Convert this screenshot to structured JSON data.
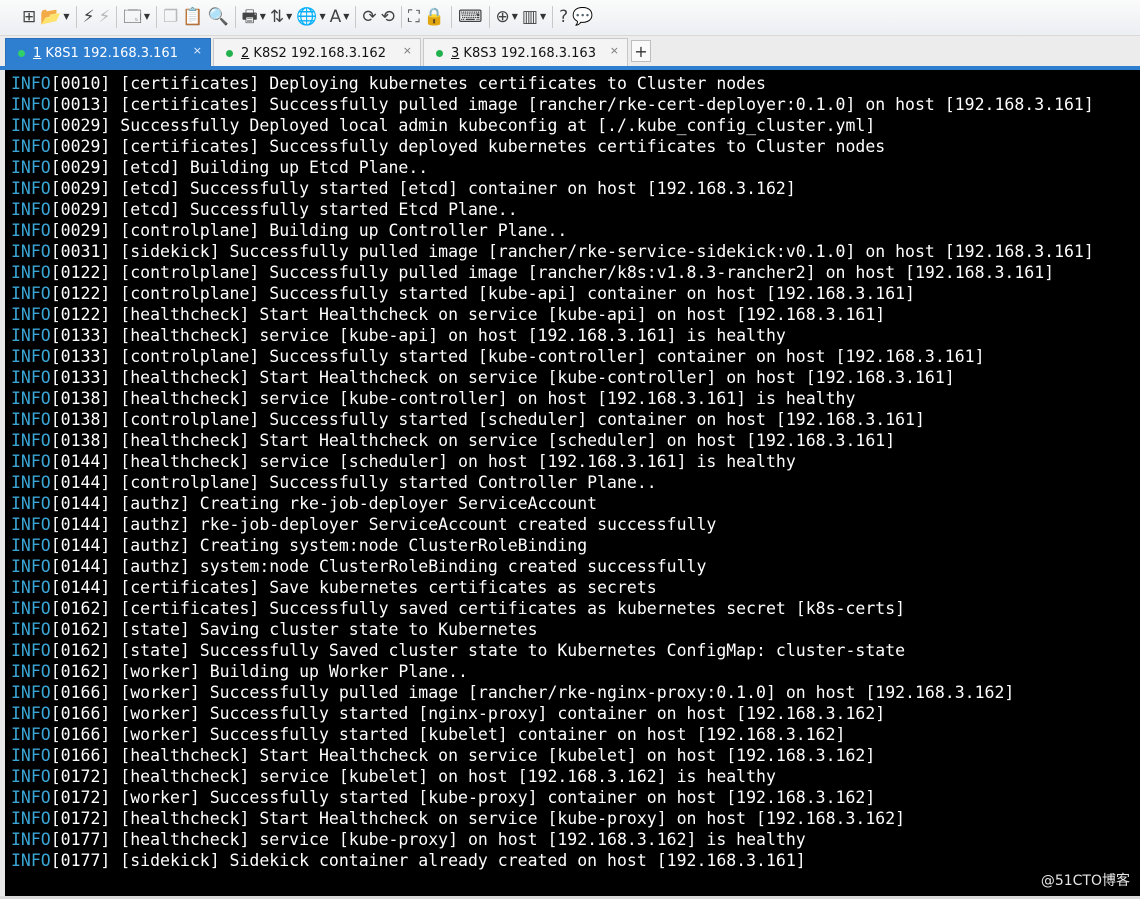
{
  "toolbar": {
    "buttons": [
      {
        "name": "new-session-icon",
        "glyph": "⊞",
        "dropdown": false
      },
      {
        "name": "open-folder-icon",
        "glyph": "📂",
        "dropdown": true
      },
      {
        "name": "connect-icon",
        "glyph": "⚡",
        "dropdown": false
      },
      {
        "name": "disconnect-icon",
        "glyph": "⚡",
        "dropdown": false,
        "dim": true
      },
      {
        "name": "new-window-icon",
        "glyph": "🗔",
        "dropdown": true
      },
      {
        "name": "copy-icon",
        "glyph": "❐",
        "dropdown": false,
        "dim": true
      },
      {
        "name": "paste-icon",
        "glyph": "📋",
        "dropdown": false
      },
      {
        "name": "find-icon",
        "glyph": "🔍",
        "dropdown": false
      },
      {
        "name": "print-icon",
        "glyph": "🖶",
        "dropdown": true
      },
      {
        "name": "transfer-icon",
        "glyph": "⇅",
        "dropdown": true
      },
      {
        "name": "globe-icon",
        "glyph": "🌐",
        "dropdown": true
      },
      {
        "name": "font-icon",
        "glyph": "A",
        "dropdown": true
      },
      {
        "name": "script-icon",
        "glyph": "⟳",
        "dropdown": false
      },
      {
        "name": "macro-icon",
        "glyph": "⟲",
        "dropdown": false
      },
      {
        "name": "fullscreen-icon",
        "glyph": "⛶",
        "dropdown": false
      },
      {
        "name": "lock-icon",
        "glyph": "🔒",
        "dropdown": false
      },
      {
        "name": "keyboard-icon",
        "glyph": "⌨",
        "dropdown": false
      },
      {
        "name": "new-tab-icon",
        "glyph": "⊕",
        "dropdown": true
      },
      {
        "name": "layout-icon",
        "glyph": "▥",
        "dropdown": true
      },
      {
        "name": "help-icon",
        "glyph": "?",
        "dropdown": false
      },
      {
        "name": "chat-icon",
        "glyph": "💬",
        "dropdown": false,
        "dim": true
      }
    ]
  },
  "tabs": [
    {
      "key": "1",
      "label": " K8S1 192.168.3.161",
      "active": true,
      "close": "×"
    },
    {
      "key": "2",
      "label": " K8S2 192.168.3.162",
      "active": false,
      "close": "×"
    },
    {
      "key": "3",
      "label": " K8S3 192.168.3.163",
      "active": false,
      "close": "×"
    }
  ],
  "add_tab_label": "+",
  "terminal": {
    "lines": [
      {
        "level": "INFO",
        "text": "[0010] [certificates] Deploying kubernetes certificates to Cluster nodes"
      },
      {
        "level": "INFO",
        "text": "[0013] [certificates] Successfully pulled image [rancher/rke-cert-deployer:0.1.0] on host [192.168.3.161]"
      },
      {
        "level": "INFO",
        "text": "[0029] Successfully Deployed local admin kubeconfig at [./.kube_config_cluster.yml]"
      },
      {
        "level": "INFO",
        "text": "[0029] [certificates] Successfully deployed kubernetes certificates to Cluster nodes"
      },
      {
        "level": "INFO",
        "text": "[0029] [etcd] Building up Etcd Plane.."
      },
      {
        "level": "INFO",
        "text": "[0029] [etcd] Successfully started [etcd] container on host [192.168.3.162]"
      },
      {
        "level": "INFO",
        "text": "[0029] [etcd] Successfully started Etcd Plane.."
      },
      {
        "level": "INFO",
        "text": "[0029] [controlplane] Building up Controller Plane.."
      },
      {
        "level": "INFO",
        "text": "[0031] [sidekick] Successfully pulled image [rancher/rke-service-sidekick:v0.1.0] on host [192.168.3.161]"
      },
      {
        "level": "INFO",
        "text": "[0122] [controlplane] Successfully pulled image [rancher/k8s:v1.8.3-rancher2] on host [192.168.3.161]"
      },
      {
        "level": "INFO",
        "text": "[0122] [controlplane] Successfully started [kube-api] container on host [192.168.3.161]"
      },
      {
        "level": "INFO",
        "text": "[0122] [healthcheck] Start Healthcheck on service [kube-api] on host [192.168.3.161]"
      },
      {
        "level": "INFO",
        "text": "[0133] [healthcheck] service [kube-api] on host [192.168.3.161] is healthy"
      },
      {
        "level": "INFO",
        "text": "[0133] [controlplane] Successfully started [kube-controller] container on host [192.168.3.161]"
      },
      {
        "level": "INFO",
        "text": "[0133] [healthcheck] Start Healthcheck on service [kube-controller] on host [192.168.3.161]"
      },
      {
        "level": "INFO",
        "text": "[0138] [healthcheck] service [kube-controller] on host [192.168.3.161] is healthy"
      },
      {
        "level": "INFO",
        "text": "[0138] [controlplane] Successfully started [scheduler] container on host [192.168.3.161]"
      },
      {
        "level": "INFO",
        "text": "[0138] [healthcheck] Start Healthcheck on service [scheduler] on host [192.168.3.161]"
      },
      {
        "level": "INFO",
        "text": "[0144] [healthcheck] service [scheduler] on host [192.168.3.161] is healthy"
      },
      {
        "level": "INFO",
        "text": "[0144] [controlplane] Successfully started Controller Plane.."
      },
      {
        "level": "INFO",
        "text": "[0144] [authz] Creating rke-job-deployer ServiceAccount"
      },
      {
        "level": "INFO",
        "text": "[0144] [authz] rke-job-deployer ServiceAccount created successfully"
      },
      {
        "level": "INFO",
        "text": "[0144] [authz] Creating system:node ClusterRoleBinding"
      },
      {
        "level": "INFO",
        "text": "[0144] [authz] system:node ClusterRoleBinding created successfully"
      },
      {
        "level": "INFO",
        "text": "[0144] [certificates] Save kubernetes certificates as secrets"
      },
      {
        "level": "INFO",
        "text": "[0162] [certificates] Successfully saved certificates as kubernetes secret [k8s-certs]"
      },
      {
        "level": "INFO",
        "text": "[0162] [state] Saving cluster state to Kubernetes"
      },
      {
        "level": "INFO",
        "text": "[0162] [state] Successfully Saved cluster state to Kubernetes ConfigMap: cluster-state"
      },
      {
        "level": "INFO",
        "text": "[0162] [worker] Building up Worker Plane.."
      },
      {
        "level": "INFO",
        "text": "[0166] [worker] Successfully pulled image [rancher/rke-nginx-proxy:0.1.0] on host [192.168.3.162]"
      },
      {
        "level": "INFO",
        "text": "[0166] [worker] Successfully started [nginx-proxy] container on host [192.168.3.162]"
      },
      {
        "level": "INFO",
        "text": "[0166] [worker] Successfully started [kubelet] container on host [192.168.3.162]"
      },
      {
        "level": "INFO",
        "text": "[0166] [healthcheck] Start Healthcheck on service [kubelet] on host [192.168.3.162]"
      },
      {
        "level": "INFO",
        "text": "[0172] [healthcheck] service [kubelet] on host [192.168.3.162] is healthy"
      },
      {
        "level": "INFO",
        "text": "[0172] [worker] Successfully started [kube-proxy] container on host [192.168.3.162]"
      },
      {
        "level": "INFO",
        "text": "[0172] [healthcheck] Start Healthcheck on service [kube-proxy] on host [192.168.3.162]"
      },
      {
        "level": "INFO",
        "text": "[0177] [healthcheck] service [kube-proxy] on host [192.168.3.162] is healthy"
      },
      {
        "level": "INFO",
        "text": "[0177] [sidekick] Sidekick container already created on host [192.168.3.161]"
      }
    ]
  },
  "watermark": "@51CTO博客",
  "colors": {
    "accent": "#2f7fd1",
    "terminal_bg": "#000000",
    "terminal_fg": "#ffffff",
    "info_level": "#3aa6d6",
    "connected_dot": "#22b14c"
  }
}
